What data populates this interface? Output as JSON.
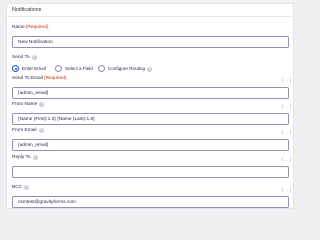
{
  "panel": {
    "title": "Notifications"
  },
  "name": {
    "label": "Name",
    "required": "(Required)",
    "value": "New Notification"
  },
  "send_to": {
    "label": "Send To",
    "help": "?",
    "options": [
      {
        "label": "Enter Email",
        "selected": true
      },
      {
        "label": "Select a Field",
        "selected": false
      },
      {
        "label": "Configure Routing",
        "selected": false
      }
    ],
    "routing_help": "?"
  },
  "send_to_email": {
    "label": "Send To Email",
    "required": "(Required)",
    "value": "{admin_email}",
    "merge_icon": "merge-tag-icon"
  },
  "from_name": {
    "label": "From Name",
    "help": "?",
    "value": "{Name (First):1.3} {Name (Last):1.6}",
    "merge_icon": "merge-tag-icon"
  },
  "from_email": {
    "label": "From Email",
    "help": "?",
    "value": "{admin_email}",
    "merge_icon": "merge-tag-icon"
  },
  "reply_to": {
    "label": "Reply To",
    "help": "?",
    "value": "",
    "merge_icon": "merge-tag-icon"
  },
  "bcc": {
    "label": "BCC",
    "help": "?",
    "value": "csmtest@gravityforms.com",
    "merge_icon": "merge-tag-icon"
  },
  "merge_glyph": "{..}",
  "colors": {
    "accent": "#204ce5",
    "required": "#c02b0a",
    "border": "#9092b2",
    "background": "#f0f0f2"
  }
}
